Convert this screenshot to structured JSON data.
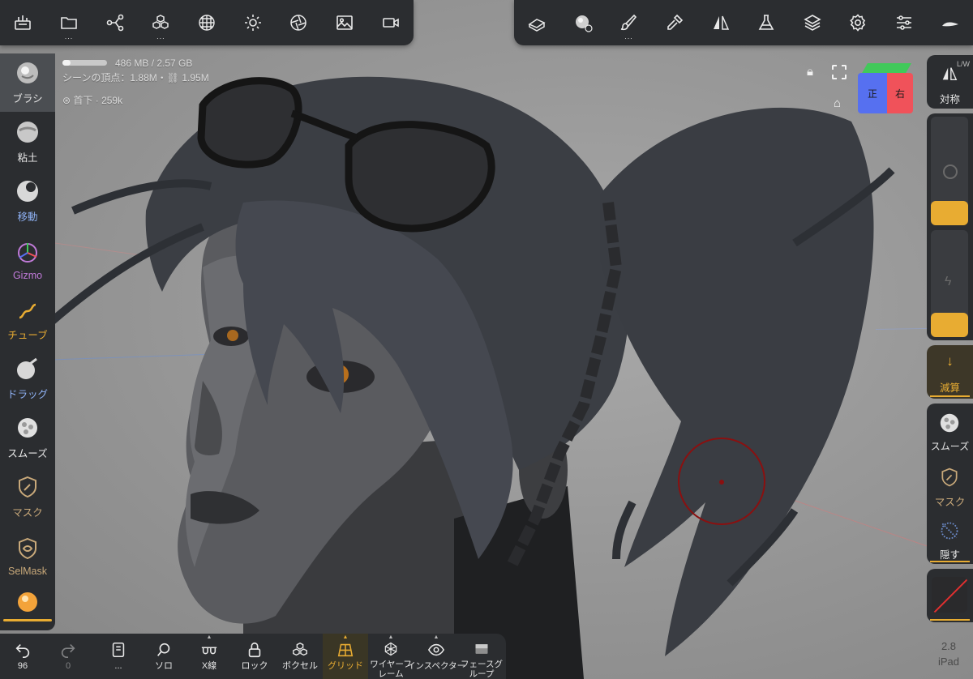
{
  "top_left_toolbar": {
    "items": [
      {
        "name": "scene-icon"
      },
      {
        "name": "files-icon",
        "more": "..."
      },
      {
        "name": "share-graph-icon"
      },
      {
        "name": "primitives-icon",
        "more": "..."
      },
      {
        "name": "mesh-sphere-icon"
      },
      {
        "name": "light-icon"
      },
      {
        "name": "camera-aperture-icon"
      },
      {
        "name": "background-image-icon"
      },
      {
        "name": "video-camera-icon"
      }
    ]
  },
  "top_right_toolbar": {
    "items": [
      {
        "name": "topology-icon"
      },
      {
        "name": "brush-material-icon"
      },
      {
        "name": "paint-icon",
        "more": "..."
      },
      {
        "name": "eyedropper-icon"
      },
      {
        "name": "symmetry-icon"
      },
      {
        "name": "flask-icon"
      },
      {
        "name": "layers-icon"
      },
      {
        "name": "settings-gear-icon"
      },
      {
        "name": "sliders-icon"
      },
      {
        "name": "stroke-icon"
      }
    ]
  },
  "stats": {
    "memory": "486 MB / 2.57 GB",
    "memory_fraction": 0.19,
    "vertices": "シーンの頂点：1.88M・",
    "vertices_selected": "1.95M",
    "selected_object": "首下 · 259k"
  },
  "tools": [
    {
      "label": "ブラシ",
      "icon": "brush-sphere-icon",
      "active": true,
      "color": "#e8e8e8"
    },
    {
      "label": "粘土",
      "icon": "clay-sphere-icon",
      "active": false,
      "color": "#e8e8e8"
    },
    {
      "label": "移動",
      "icon": "move-sphere-icon",
      "active": false,
      "color": "#8fb2f5"
    },
    {
      "label": "Gizmo",
      "icon": "gizmo-icon",
      "active": false,
      "color": "#c07ad8"
    },
    {
      "label": "チューブ",
      "icon": "tube-icon",
      "active": false,
      "color": "#e8ac32"
    },
    {
      "label": "ドラッグ",
      "icon": "drag-sphere-icon",
      "active": false,
      "color": "#8fb2f5"
    },
    {
      "label": "スムーズ",
      "icon": "smooth-icon",
      "active": false,
      "color": "#e8e8e8"
    },
    {
      "label": "マスク",
      "icon": "mask-icon",
      "active": false,
      "color": "#c9a97a"
    },
    {
      "label": "SelMask",
      "icon": "selmask-icon",
      "active": false,
      "color": "#c9a97a"
    }
  ],
  "view_cube": {
    "front": "正",
    "right": "右"
  },
  "right_panel": {
    "lw_label": "L/W",
    "symmetry_label": "対称",
    "subtract_label": "減算",
    "smooth_label": "スムーズ",
    "mask_label": "マスク",
    "hide_label": "隠す"
  },
  "bottom_bar": {
    "items": [
      {
        "name": "undo",
        "label": "96",
        "icon": "undo-icon"
      },
      {
        "name": "redo",
        "label": "0",
        "icon": "redo-icon"
      },
      {
        "name": "menu",
        "label": "...",
        "icon": "book-icon"
      },
      {
        "name": "solo",
        "label": "ソロ",
        "icon": "search-solo-icon"
      },
      {
        "name": "xray",
        "label": "X線",
        "icon": "glasses-icon"
      },
      {
        "name": "lock",
        "label": "ロック",
        "icon": "lock-icon"
      },
      {
        "name": "voxel",
        "label": "ボクセル",
        "icon": "voxel-icon"
      },
      {
        "name": "grid",
        "label": "グリッド",
        "icon": "grid-icon",
        "on": true
      },
      {
        "name": "wireframe",
        "label": "ワイヤーフレーム",
        "icon": "wireframe-icon"
      },
      {
        "name": "inspector",
        "label": "インスペクター",
        "icon": "inspector-eye-icon"
      },
      {
        "name": "face-group",
        "label": "フェースグループ",
        "icon": "face-group-icon"
      }
    ]
  },
  "version": {
    "number": "2.8",
    "device": "iPad"
  },
  "colors": {
    "accent": "#e8ac32",
    "panel": "#2b2d30",
    "brush_ring": "#8a1010"
  }
}
